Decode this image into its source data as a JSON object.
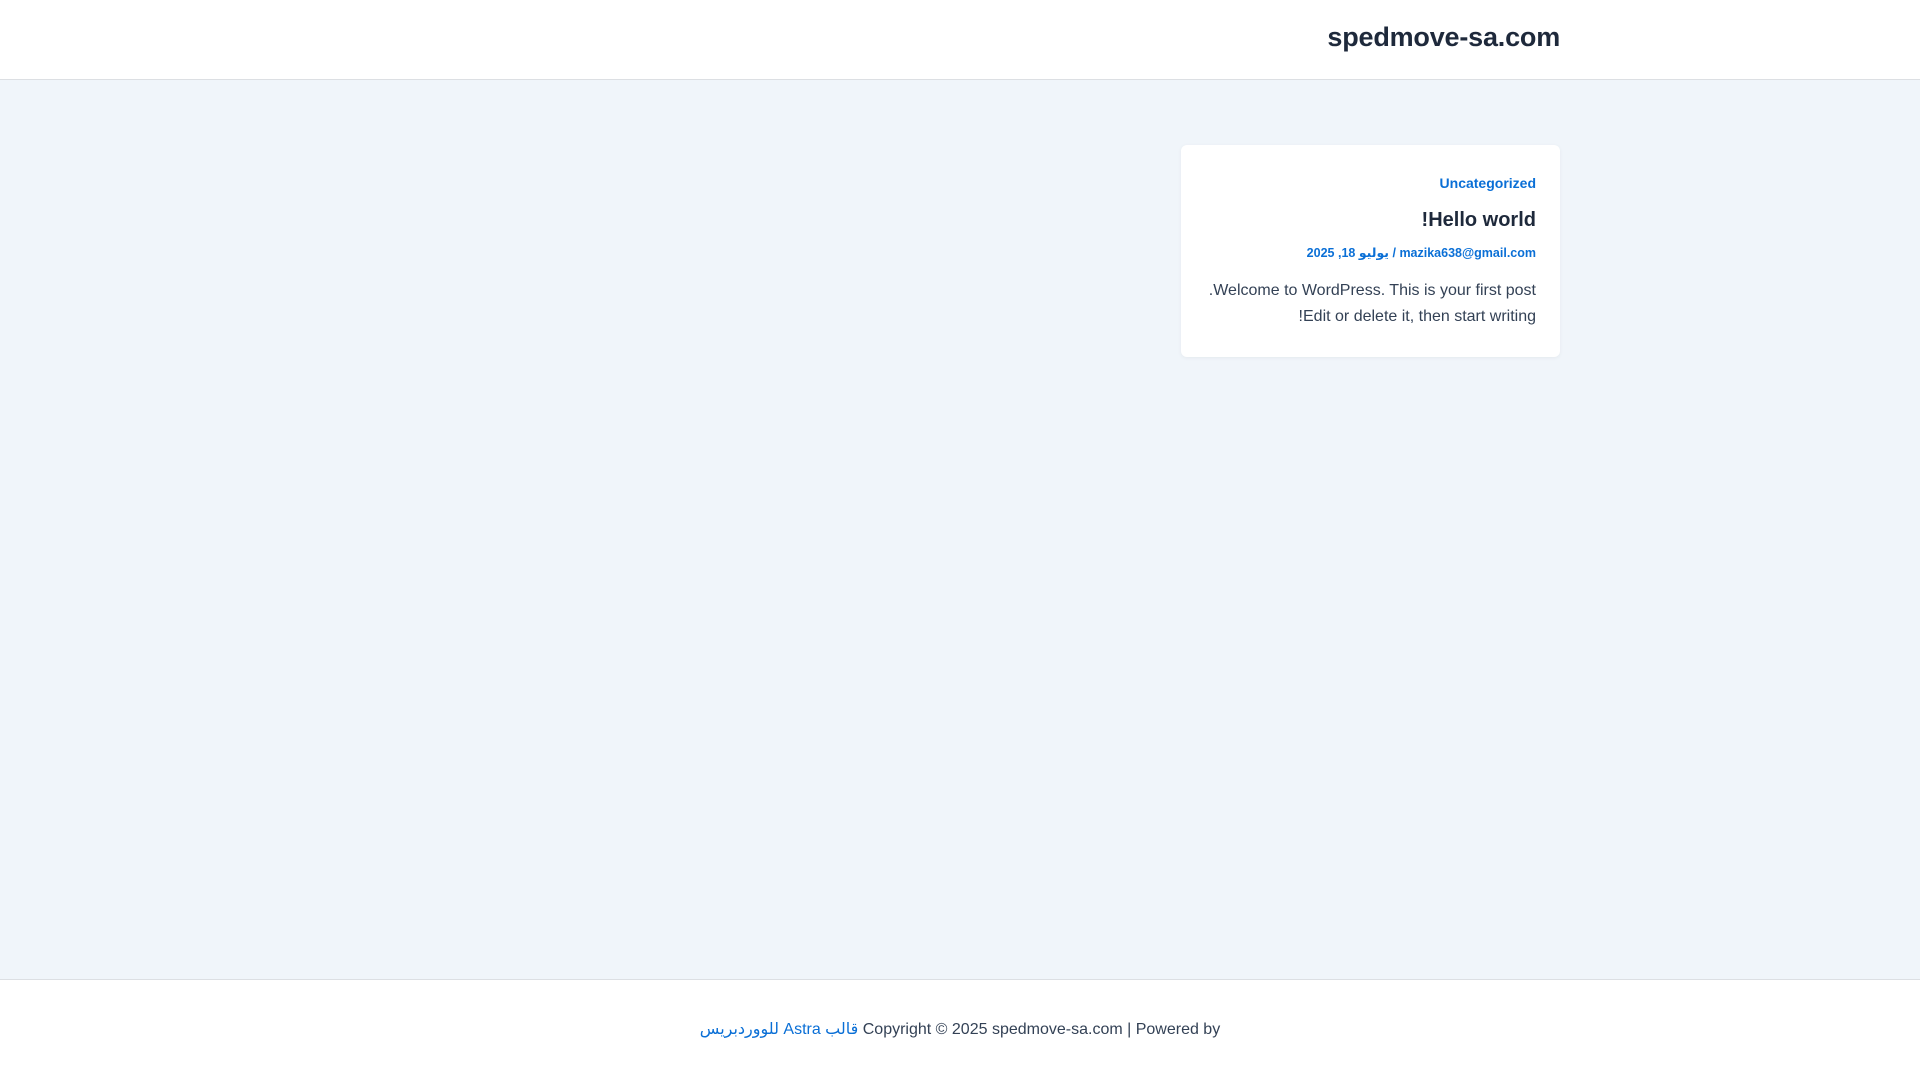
{
  "header": {
    "site_title": "spedmove-sa.com"
  },
  "post": {
    "category": "Uncategorized",
    "title": "Hello world!",
    "author": "mazika638@gmail.com",
    "meta_separator": "/",
    "date": "يوليو 18, 2025",
    "excerpt_line1": "Welcome to WordPress. This is your first post.",
    "excerpt_line2": "Edit or delete it, then start writing!"
  },
  "footer": {
    "copyright_text": "Copyright © 2025 spedmove-sa.com | Powered by",
    "theme_link": "قالب Astra للووردبريس"
  },
  "colors": {
    "accent": "#0a6fd6",
    "heading": "#1e293b",
    "body_bg": "#f0f5fa"
  }
}
